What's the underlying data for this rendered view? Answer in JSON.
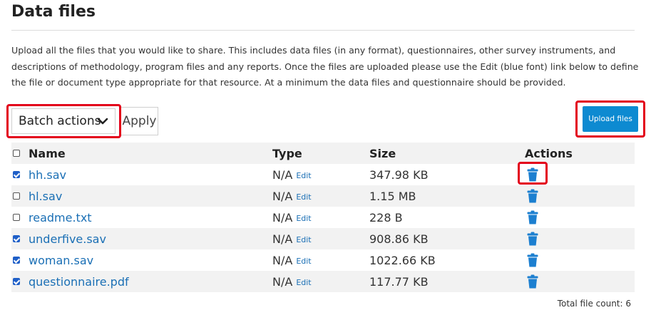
{
  "page": {
    "title": "Data files",
    "description": "Upload all the files that you would like to share. This includes data files (in any format), questionnaires, other survey instruments, and descriptions of methodology, program files and any reports. Once the files are uploaded please use the Edit (blue font) link below to define the file or document type appropriate for that resource. At a minimum the data files and questionnaire should be provided."
  },
  "toolbar": {
    "batch_actions_label": "Batch actions",
    "apply_label": "Apply",
    "upload_label": "Upload files"
  },
  "table": {
    "headers": {
      "name": "Name",
      "type": "Type",
      "size": "Size",
      "actions": "Actions"
    },
    "rows": [
      {
        "name": "hh.sav",
        "type": "N/A",
        "edit": "Edit",
        "size": "347.98 KB",
        "checked": true
      },
      {
        "name": "hl.sav",
        "type": "N/A",
        "edit": "Edit",
        "size": "1.15 MB",
        "checked": false
      },
      {
        "name": "readme.txt",
        "type": "N/A",
        "edit": "Edit",
        "size": "228 B",
        "checked": false
      },
      {
        "name": "underfive.sav",
        "type": "N/A",
        "edit": "Edit",
        "size": "908.86 KB",
        "checked": true
      },
      {
        "name": "woman.sav",
        "type": "N/A",
        "edit": "Edit",
        "size": "1022.66 KB",
        "checked": true
      },
      {
        "name": "questionnaire.pdf",
        "type": "N/A",
        "edit": "Edit",
        "size": "117.77 KB",
        "checked": true
      }
    ]
  },
  "footer": {
    "file_count": "Total file count: 6"
  },
  "icons": {
    "row_action": "trash-icon",
    "batch_dropdown": "chevron-down-icon"
  },
  "colors": {
    "accent": "#0d8ad1",
    "link": "#1a6fb5",
    "highlight": "#e3001b",
    "checkbox": "#1f5fc8",
    "trash": "#1c7fd0"
  }
}
